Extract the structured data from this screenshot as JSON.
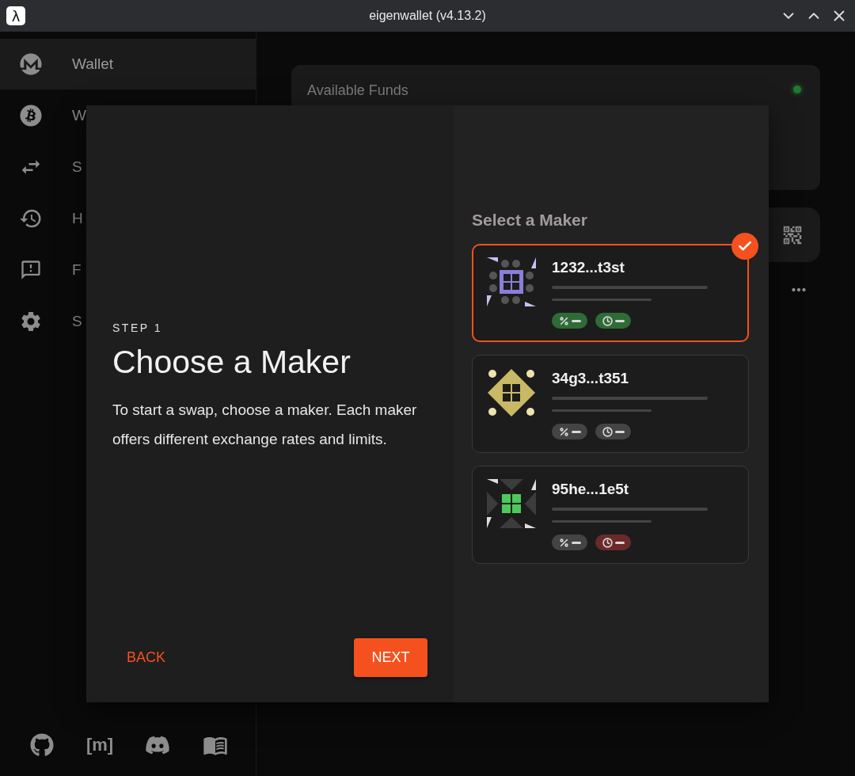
{
  "window": {
    "app_icon": "λ",
    "title": "eigenwallet (v4.13.2)"
  },
  "sidebar": {
    "items": [
      {
        "kind": "monero",
        "label": "Wallet",
        "selected": true
      },
      {
        "kind": "bitcoin",
        "label": "W",
        "selected": false
      },
      {
        "kind": "swap",
        "label": "S",
        "selected": false
      },
      {
        "kind": "history",
        "label": "H",
        "selected": false
      },
      {
        "kind": "feedback",
        "label": "F",
        "selected": false
      },
      {
        "kind": "settings",
        "label": "S",
        "selected": false
      }
    ],
    "footer": [
      {
        "kind": "github"
      },
      {
        "kind": "matrix",
        "label": "[m]"
      },
      {
        "kind": "discord"
      },
      {
        "kind": "docs"
      }
    ]
  },
  "main": {
    "funds_card": {
      "title": "Available Funds",
      "connected": true
    }
  },
  "dialog": {
    "step": "STEP 1",
    "title": "Choose a Maker",
    "text": "To start a swap, choose a maker. Each maker offers different exchange rates and limits.",
    "back": "BACK",
    "next": "NEXT",
    "makers_title": "Select a Maker",
    "makers": [
      {
        "name": "1232...t3st",
        "kind": "purple-grid",
        "selected": true,
        "chips": [
          {
            "kind": "fee",
            "color": "#2e6b36"
          },
          {
            "kind": "time",
            "color": "#2e6b36"
          }
        ]
      },
      {
        "name": "34g3...t351",
        "kind": "gold-diamond",
        "selected": false,
        "chips": [
          {
            "kind": "fee",
            "color": "#444444"
          },
          {
            "kind": "time",
            "color": "#444444"
          }
        ]
      },
      {
        "name": "95he...1e5t",
        "kind": "green-star",
        "selected": false,
        "chips": [
          {
            "kind": "fee",
            "color": "#444444"
          },
          {
            "kind": "time",
            "color": "#6b2a2a"
          }
        ]
      }
    ]
  }
}
